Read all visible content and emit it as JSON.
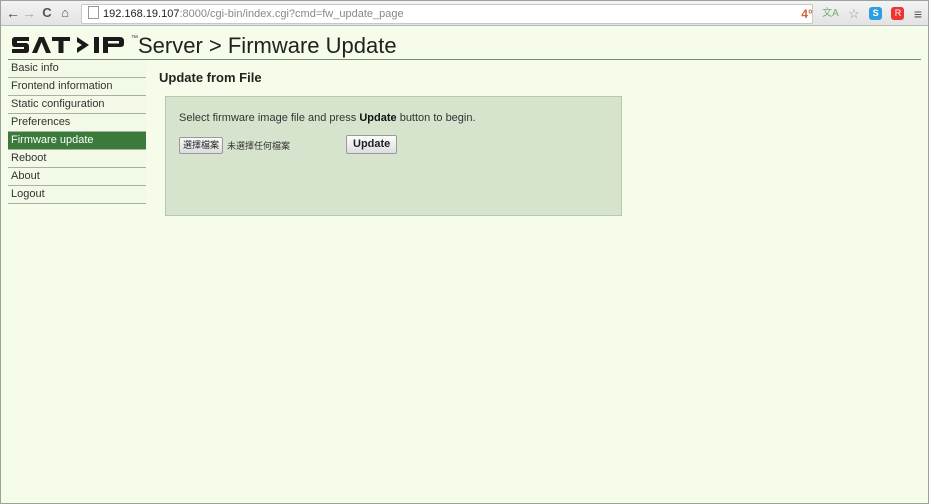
{
  "browser": {
    "back_glyph": "←",
    "forward_glyph": "→",
    "reload_glyph": "C",
    "home_glyph": "⌂",
    "url_host": "192.168.19.107",
    "url_rest": ":8000/cgi-bin/index.cgi?cmd=fw_update_page",
    "ext_weather": "4°",
    "ext_translate": "文A",
    "ext_s": "S",
    "ext_red": "R",
    "menu_glyph": "≡",
    "star_glyph": "☆"
  },
  "header": {
    "logo_text": "SAT>IP",
    "trademark": "™",
    "title": "Server > Firmware Update"
  },
  "sidebar": {
    "items": [
      {
        "label": "Basic info",
        "active": false
      },
      {
        "label": "Frontend information",
        "active": false
      },
      {
        "label": "Static configuration",
        "active": false
      },
      {
        "label": "Preferences",
        "active": false
      },
      {
        "label": "Firmware update",
        "active": true
      },
      {
        "label": "Reboot",
        "active": false
      },
      {
        "label": "About",
        "active": false
      },
      {
        "label": "Logout",
        "active": false
      }
    ]
  },
  "main": {
    "section_title": "Update from File",
    "instruction_pre": "Select firmware image file and press ",
    "instruction_bold": "Update",
    "instruction_post": " button to begin.",
    "choose_file_label": "選擇檔案",
    "no_file_text": "未選擇任何檔案",
    "update_button_label": "Update"
  },
  "colors": {
    "page_bg": "#f5fce9",
    "active_nav": "#3a7a3a",
    "panel_bg": "#d7e4cd"
  }
}
